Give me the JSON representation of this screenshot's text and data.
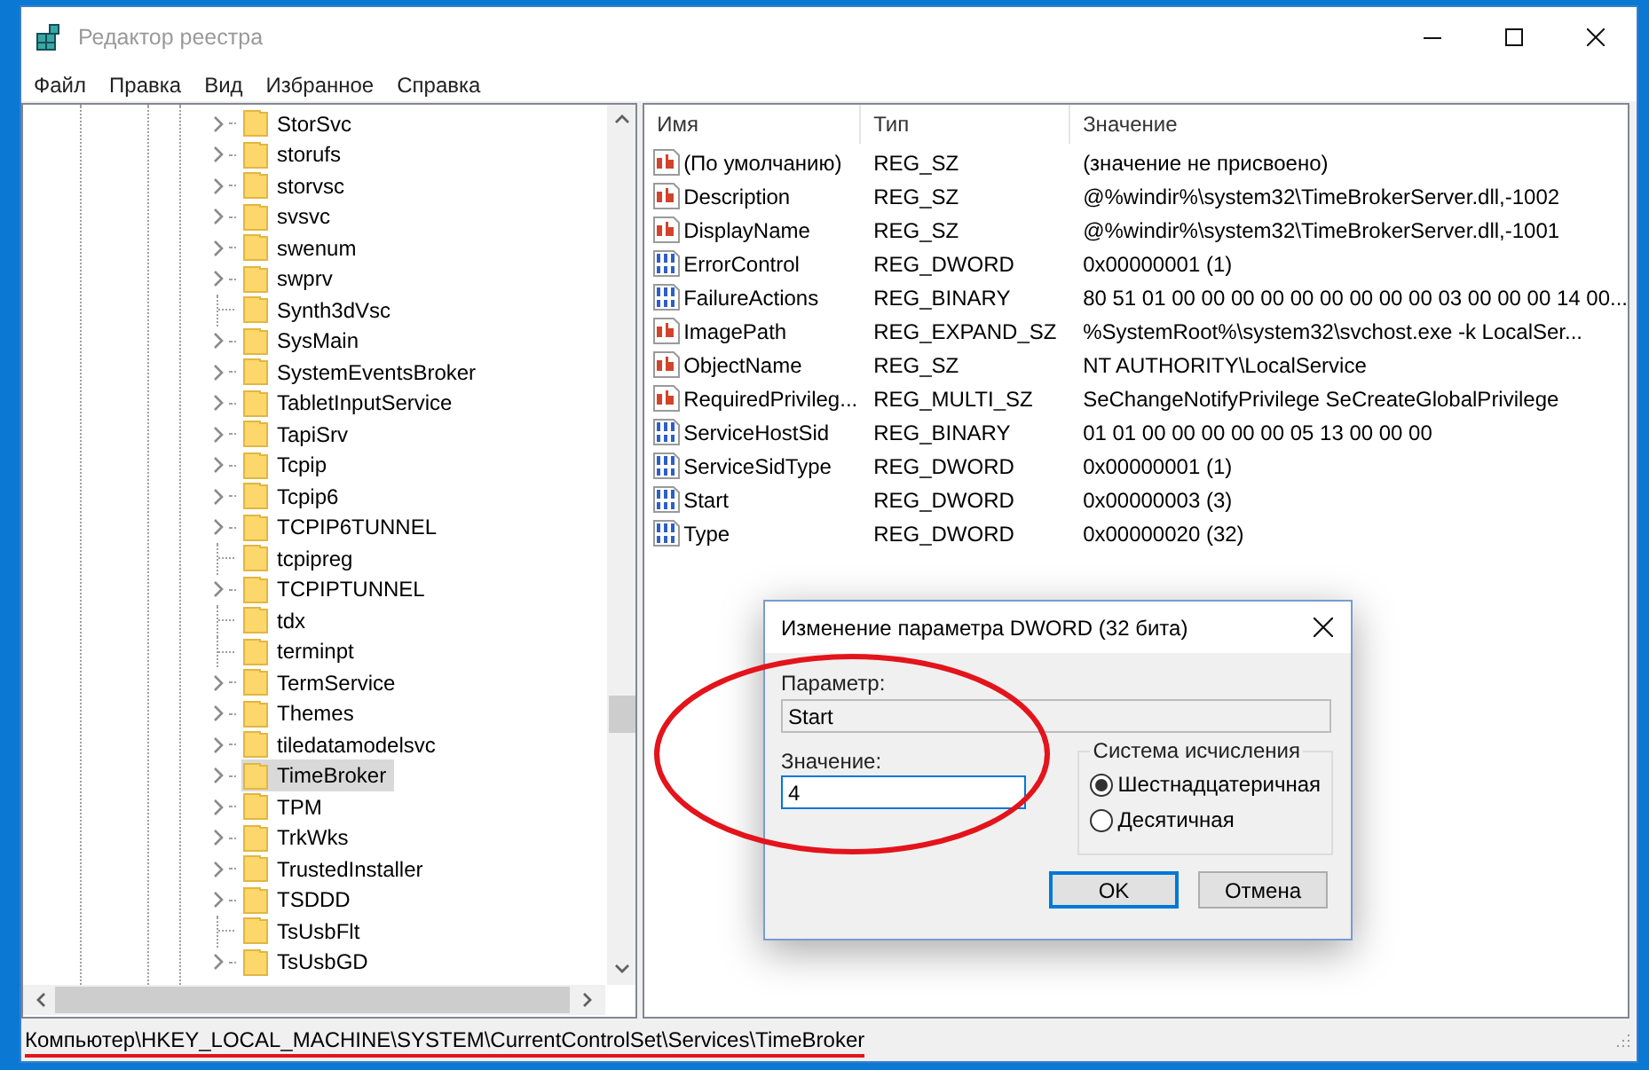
{
  "window": {
    "title": "Редактор реестра"
  },
  "menu": [
    "Файл",
    "Правка",
    "Вид",
    "Избранное",
    "Справка"
  ],
  "tree": {
    "items": [
      {
        "label": "StorSvc",
        "expandable": true,
        "selected": false
      },
      {
        "label": "storufs",
        "expandable": true,
        "selected": false
      },
      {
        "label": "storvsc",
        "expandable": true,
        "selected": false
      },
      {
        "label": "svsvc",
        "expandable": true,
        "selected": false
      },
      {
        "label": "swenum",
        "expandable": true,
        "selected": false
      },
      {
        "label": "swprv",
        "expandable": true,
        "selected": false
      },
      {
        "label": "Synth3dVsc",
        "expandable": false,
        "selected": false
      },
      {
        "label": "SysMain",
        "expandable": true,
        "selected": false
      },
      {
        "label": "SystemEventsBroker",
        "expandable": true,
        "selected": false
      },
      {
        "label": "TabletInputService",
        "expandable": true,
        "selected": false
      },
      {
        "label": "TapiSrv",
        "expandable": true,
        "selected": false
      },
      {
        "label": "Tcpip",
        "expandable": true,
        "selected": false
      },
      {
        "label": "Tcpip6",
        "expandable": true,
        "selected": false
      },
      {
        "label": "TCPIP6TUNNEL",
        "expandable": true,
        "selected": false
      },
      {
        "label": "tcpipreg",
        "expandable": false,
        "selected": false
      },
      {
        "label": "TCPIPTUNNEL",
        "expandable": true,
        "selected": false
      },
      {
        "label": "tdx",
        "expandable": false,
        "selected": false
      },
      {
        "label": "terminpt",
        "expandable": false,
        "selected": false
      },
      {
        "label": "TermService",
        "expandable": true,
        "selected": false
      },
      {
        "label": "Themes",
        "expandable": true,
        "selected": false
      },
      {
        "label": "tiledatamodelsvc",
        "expandable": true,
        "selected": false
      },
      {
        "label": "TimeBroker",
        "expandable": true,
        "selected": true
      },
      {
        "label": "TPM",
        "expandable": true,
        "selected": false
      },
      {
        "label": "TrkWks",
        "expandable": true,
        "selected": false
      },
      {
        "label": "TrustedInstaller",
        "expandable": true,
        "selected": false
      },
      {
        "label": "TSDDD",
        "expandable": true,
        "selected": false
      },
      {
        "label": "TsUsbFlt",
        "expandable": false,
        "selected": false
      },
      {
        "label": "TsUsbGD",
        "expandable": true,
        "selected": false
      }
    ]
  },
  "values": {
    "columns": [
      "Имя",
      "Тип",
      "Значение"
    ],
    "rows": [
      {
        "kind": "string",
        "name": "(По умолчанию)",
        "type": "REG_SZ",
        "data": "(значение не присвоено)"
      },
      {
        "kind": "string",
        "name": "Description",
        "type": "REG_SZ",
        "data": "@%windir%\\system32\\TimeBrokerServer.dll,-1002"
      },
      {
        "kind": "string",
        "name": "DisplayName",
        "type": "REG_SZ",
        "data": "@%windir%\\system32\\TimeBrokerServer.dll,-1001"
      },
      {
        "kind": "binary",
        "name": "ErrorControl",
        "type": "REG_DWORD",
        "data": "0x00000001 (1)"
      },
      {
        "kind": "binary",
        "name": "FailureActions",
        "type": "REG_BINARY",
        "data": "80 51 01 00 00 00 00 00 00 00 00 00 03 00 00 00 14 00..."
      },
      {
        "kind": "string",
        "name": "ImagePath",
        "type": "REG_EXPAND_SZ",
        "data": "%SystemRoot%\\system32\\svchost.exe -k LocalSer..."
      },
      {
        "kind": "string",
        "name": "ObjectName",
        "type": "REG_SZ",
        "data": "NT AUTHORITY\\LocalService"
      },
      {
        "kind": "string",
        "name": "RequiredPrivileg...",
        "type": "REG_MULTI_SZ",
        "data": "SeChangeNotifyPrivilege SeCreateGlobalPrivilege"
      },
      {
        "kind": "binary",
        "name": "ServiceHostSid",
        "type": "REG_BINARY",
        "data": "01 01 00 00 00 00 00 05 13 00 00 00"
      },
      {
        "kind": "binary",
        "name": "ServiceSidType",
        "type": "REG_DWORD",
        "data": "0x00000001 (1)"
      },
      {
        "kind": "binary",
        "name": "Start",
        "type": "REG_DWORD",
        "data": "0x00000003 (3)"
      },
      {
        "kind": "binary",
        "name": "Type",
        "type": "REG_DWORD",
        "data": "0x00000020 (32)"
      }
    ]
  },
  "dialog": {
    "title": "Изменение параметра DWORD (32 бита)",
    "name_label": "Параметр:",
    "name_value": "Start",
    "value_label": "Значение:",
    "value": "4",
    "base_group": "Система исчисления",
    "bases": [
      {
        "label": "Шестнадцатеричная",
        "selected": true
      },
      {
        "label": "Десятичная",
        "selected": false
      }
    ],
    "buttons": [
      {
        "label": "OK",
        "default": true
      },
      {
        "label": "Отмена",
        "default": false
      }
    ]
  },
  "status_bar": "Компьютер\\HKEY_LOCAL_MACHINE\\SYSTEM\\CurrentControlSet\\Services\\TimeBroker"
}
